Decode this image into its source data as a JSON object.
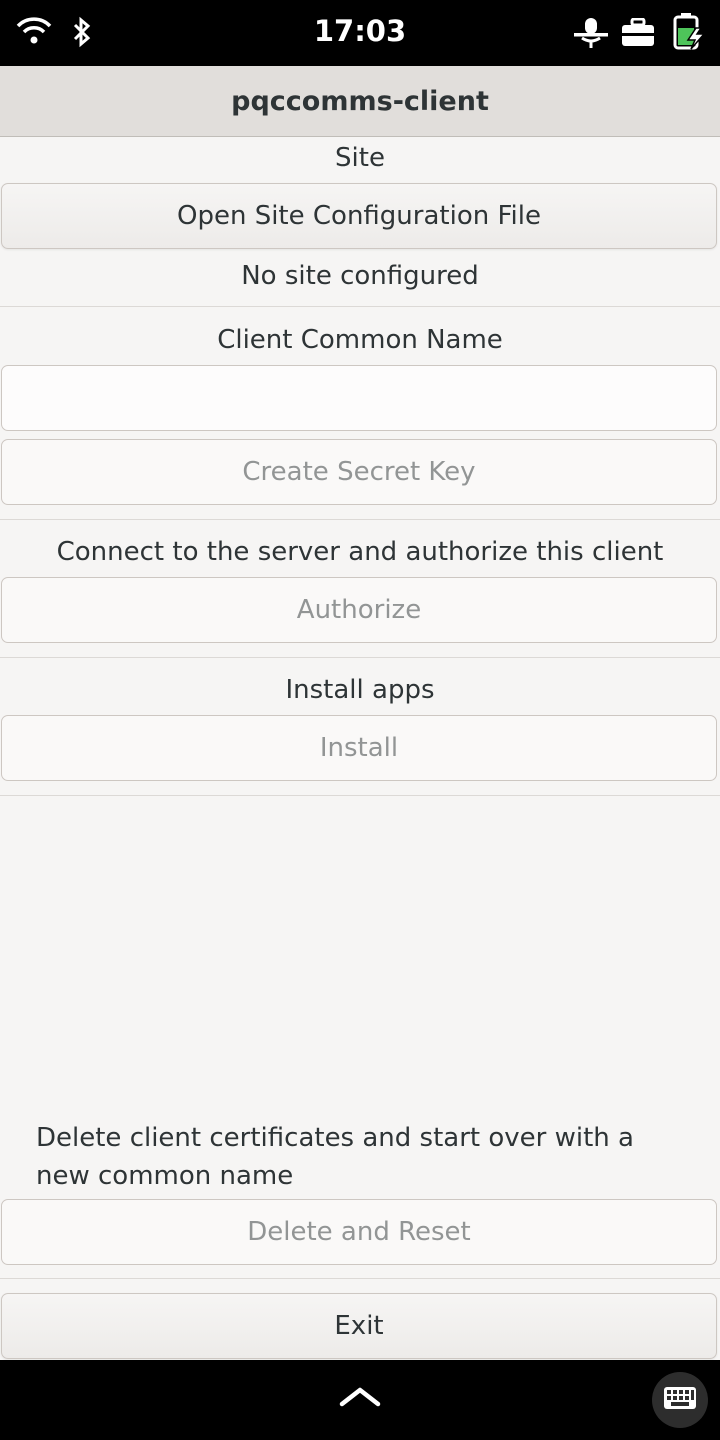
{
  "status_bar": {
    "time": "17:03",
    "icons": [
      "wifi-icon",
      "bluetooth-icon",
      "microphone-muted-icon",
      "briefcase-icon",
      "battery-charging-icon"
    ]
  },
  "header": {
    "title": "pqccomms-client"
  },
  "site": {
    "label": "Site",
    "open_button": "Open Site Configuration File",
    "status": "No site configured"
  },
  "client": {
    "label": "Client Common Name",
    "input_value": "",
    "create_button": "Create Secret Key"
  },
  "authorize": {
    "label": "Connect to the server and authorize this client",
    "button": "Authorize"
  },
  "install": {
    "label": "Install apps",
    "button": "Install"
  },
  "reset": {
    "label": "Delete client certificates and start over with a new common name",
    "button": "Delete and Reset"
  },
  "exit_button": "Exit",
  "nav": {
    "icons": [
      "chevron-up-icon",
      "keyboard-icon"
    ]
  },
  "colors": {
    "window_bg": "#f6f5f4",
    "header_bg": "#e1dedb",
    "disabled_text": "#929595"
  }
}
